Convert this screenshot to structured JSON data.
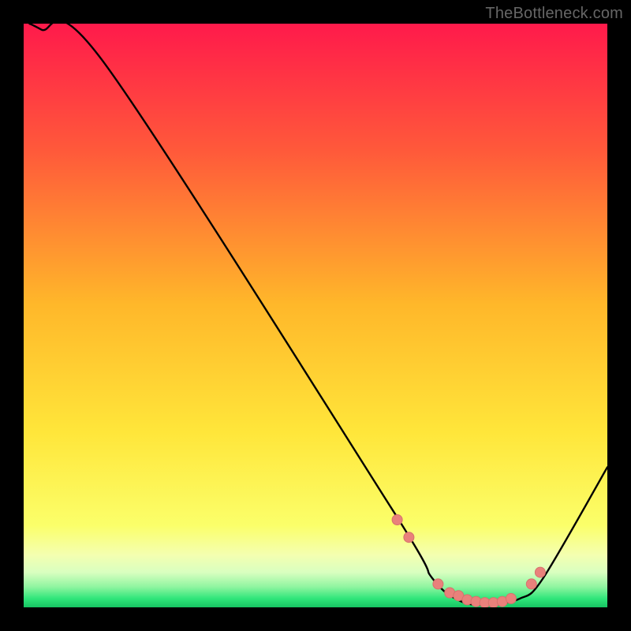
{
  "watermark": "TheBottleneck.com",
  "colors": {
    "black": "#000000",
    "curve": "#000000",
    "marker_fill": "#e9817b",
    "marker_stroke": "#d6726c",
    "grad_top": "#ff1a4b",
    "grad_mid1": "#ff7a2a",
    "grad_mid2": "#ffe63a",
    "grad_band": "#f4ffb0",
    "grad_green": "#2fe67a"
  },
  "chart_data": {
    "type": "line",
    "title": "",
    "xlabel": "",
    "ylabel": "",
    "xlim": [
      0,
      100
    ],
    "ylim": [
      0,
      100
    ],
    "series": [
      {
        "name": "curve",
        "x": [
          1,
          3,
          14,
          63,
          70,
          75,
          80,
          85,
          89,
          100
        ],
        "y": [
          100,
          99,
          93,
          17,
          5,
          1,
          0.5,
          1.5,
          5,
          24
        ]
      }
    ],
    "markers": {
      "name": "optimal-band-points",
      "x": [
        64,
        66,
        71,
        73,
        74.5,
        76,
        77.5,
        79,
        80.5,
        82,
        83.5,
        87,
        88.5
      ],
      "y": [
        15,
        12,
        4,
        2.5,
        2,
        1.3,
        1,
        0.8,
        0.8,
        1,
        1.5,
        4,
        6
      ]
    }
  }
}
